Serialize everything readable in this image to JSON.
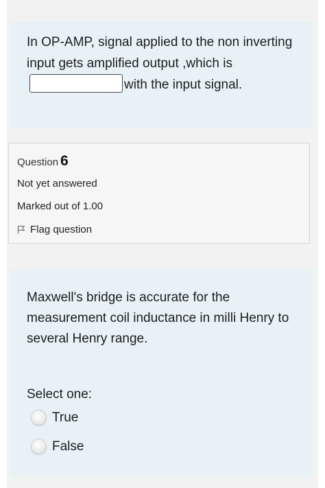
{
  "question5": {
    "text_before": "In OP-AMP, signal applied to the non inverting input gets amplified output ,which is",
    "answer_value": "",
    "text_after": "with the input signal."
  },
  "question6": {
    "label": "Question",
    "number": "6",
    "status": "Not yet answered",
    "marks": "Marked out of 1.00",
    "flag_label": "Flag question",
    "flag_icon": "flag-outline-icon",
    "text": "Maxwell's bridge  is accurate for the measurement  coil inductance in milli Henry to several Henry range.",
    "prompt": "Select one:",
    "options": [
      {
        "label": "True",
        "selected": false
      },
      {
        "label": "False",
        "selected": false
      }
    ]
  }
}
